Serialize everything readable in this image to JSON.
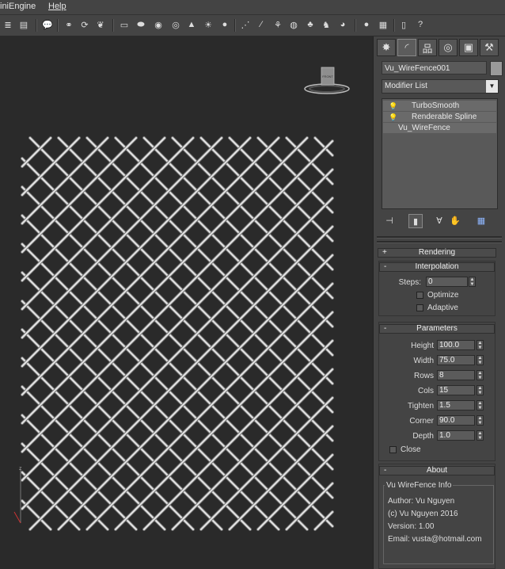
{
  "menubar": {
    "items": [
      "iniEngine",
      "Help"
    ]
  },
  "toolbar": {
    "icons": [
      "list-icon",
      "grid-icon",
      "chat-icon",
      "link-icon",
      "unlink-icon",
      "bind-icon",
      "rect-icon",
      "ellipse-icon",
      "circle-icon",
      "eye-icon",
      "cone-icon",
      "sun-icon",
      "sphere-icon",
      "path-icon",
      "wand-icon",
      "tree-icon",
      "globe-icon",
      "leaf-icon",
      "bird-icon",
      "shell-icon",
      "ball-icon",
      "grid-layout-icon",
      "note-icon",
      "help-icon"
    ]
  },
  "command_panel": {
    "tabs": [
      {
        "name": "create-tab",
        "glyph": "✸"
      },
      {
        "name": "modify-tab",
        "glyph": "◜"
      },
      {
        "name": "hierarchy-tab",
        "glyph": "品"
      },
      {
        "name": "motion-tab",
        "glyph": "◎"
      },
      {
        "name": "display-tab",
        "glyph": "▣"
      },
      {
        "name": "utilities-tab",
        "glyph": "⚒"
      }
    ],
    "object_name": "Vu_WireFence001",
    "object_color": "#9a9a9a",
    "modifier_list_label": "Modifier List",
    "stack": [
      {
        "label": "TurboSmooth",
        "bulb": "💡"
      },
      {
        "label": "Renderable Spline",
        "bulb": "💡"
      },
      {
        "label": "Vu_WireFence",
        "bulb": ""
      }
    ]
  },
  "rendering": {
    "sign": "+",
    "title": "Rendering"
  },
  "interpolation": {
    "sign": "-",
    "title": "Interpolation",
    "steps_label": "Steps:",
    "steps_value": "0",
    "optimize_label": "Optimize",
    "adaptive_label": "Adaptive"
  },
  "parameters": {
    "sign": "-",
    "title": "Parameters",
    "fields": [
      {
        "label": "Height",
        "value": "100.0"
      },
      {
        "label": "Width",
        "value": "75.0"
      },
      {
        "label": "Rows",
        "value": "8"
      },
      {
        "label": "Cols",
        "value": "15"
      },
      {
        "label": "Tighten",
        "value": "1.5"
      },
      {
        "label": "Corner",
        "value": "90.0"
      },
      {
        "label": "Depth",
        "value": "1.0"
      }
    ],
    "close_label": "Close"
  },
  "about": {
    "sign": "-",
    "title": "About",
    "group_title": "Vu WireFence Info",
    "lines": [
      "Author: Vu Nguyen",
      "(c) Vu Nguyen 2016",
      "Version: 1.00",
      "Email: vusta@hotmail.com"
    ]
  },
  "viewport": {
    "viewcube_label": "FRONT",
    "background": "#2a2a2a",
    "wire_color": "#e4e4e4"
  }
}
